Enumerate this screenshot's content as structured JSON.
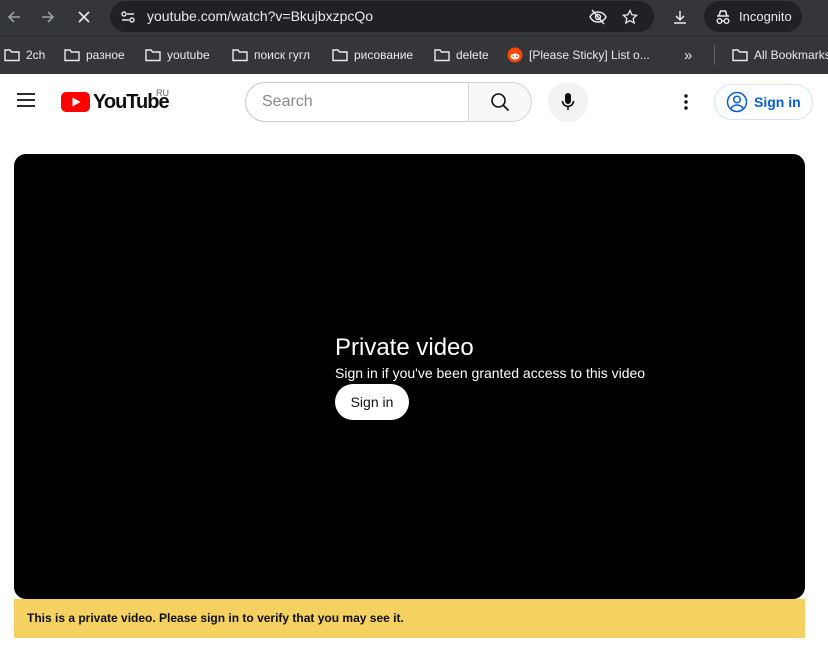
{
  "browser": {
    "url": "youtube.com/watch?v=BkujbxzpcQo",
    "incognito_label": "Incognito",
    "icons": [
      "back-arrow-icon",
      "forward-arrow-icon",
      "stop-loading-icon",
      "site-settings-icon",
      "eye-off-icon",
      "star-icon",
      "download-icon",
      "incognito-icon"
    ]
  },
  "bookmarks": {
    "items": [
      {
        "label": "2ch",
        "icon": "folder-icon"
      },
      {
        "label": "разное",
        "icon": "folder-icon"
      },
      {
        "label": "youtube",
        "icon": "folder-icon"
      },
      {
        "label": "поиск гугл",
        "icon": "folder-icon"
      },
      {
        "label": "рисование",
        "icon": "folder-icon"
      },
      {
        "label": "delete",
        "icon": "folder-icon"
      },
      {
        "label": "[Please Sticky] List o...",
        "icon": "reddit-icon"
      }
    ],
    "overflow": "»",
    "all_bookmarks": "All Bookmarks"
  },
  "header": {
    "logo_text": "YouTube",
    "region": "RU",
    "search_placeholder": "Search",
    "sign_in_label": "Sign in"
  },
  "player": {
    "title": "Private video",
    "subtitle": "Sign in if you've been granted access to this video",
    "button_label": "Sign in"
  },
  "banner": {
    "text": "This is a private video. Please sign in to verify that you may see it."
  },
  "colors": {
    "chrome_bg": "#35363a",
    "pill_bg": "#202124",
    "youtube_red": "#ff0000",
    "link_blue": "#065fd4",
    "banner_yellow": "#f4d160",
    "player_bg": "#000000"
  }
}
